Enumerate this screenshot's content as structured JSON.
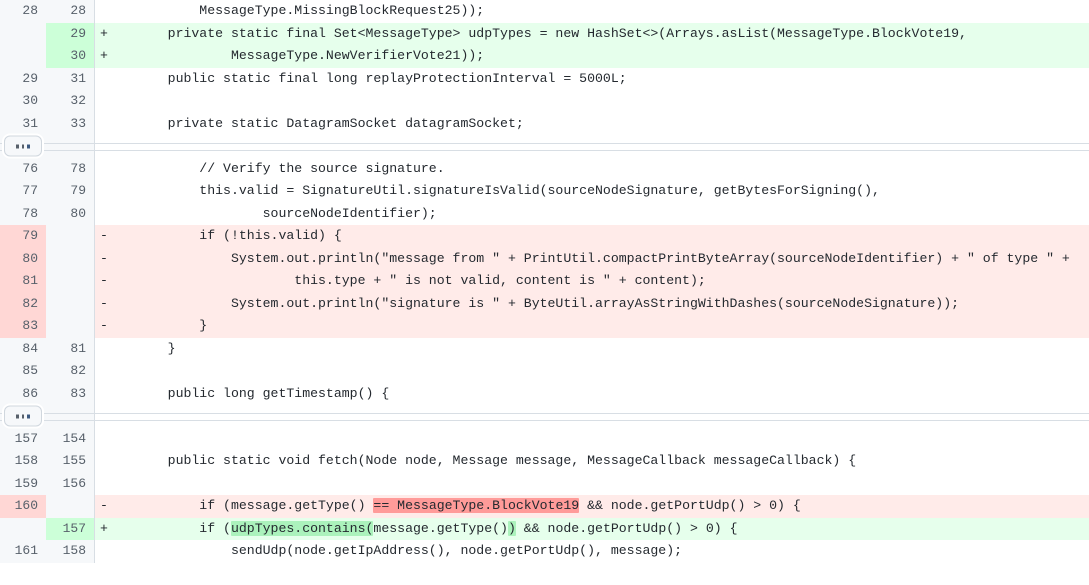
{
  "view": {
    "type": "unified-diff",
    "language": "java",
    "colors": {
      "added_bg": "#e6ffec",
      "added_gutter_bg": "#ccffd8",
      "added_word_highlight": "#abf2bc",
      "deleted_bg": "#ffebe9",
      "deleted_gutter_bg": "#ffd7d5",
      "deleted_word_highlight": "#ff9b99",
      "context_bg": "#ffffff",
      "gutter_bg": "#f6f8fa",
      "gutter_text": "#57606a",
      "code_text": "#24292f",
      "border": "#d8dee4"
    }
  },
  "expanders": [
    {
      "label": "...",
      "title": "Expand hidden lines"
    },
    {
      "label": "...",
      "title": "Expand hidden lines"
    }
  ],
  "rows": [
    {
      "kind": "context",
      "old": "28",
      "new": "28",
      "marker": "",
      "code": "        MessageType.MissingBlockRequest25));"
    },
    {
      "kind": "add",
      "old": "",
      "new": "29",
      "marker": "+",
      "code": "    private static final Set<MessageType> udpTypes = new HashSet<>(Arrays.asList(MessageType.BlockVote19,"
    },
    {
      "kind": "add",
      "old": "",
      "new": "30",
      "marker": "+",
      "code": "            MessageType.NewVerifierVote21));"
    },
    {
      "kind": "context",
      "old": "29",
      "new": "31",
      "marker": "",
      "code": "    public static final long replayProtectionInterval = 5000L;"
    },
    {
      "kind": "context",
      "old": "30",
      "new": "32",
      "marker": "",
      "code": ""
    },
    {
      "kind": "context",
      "old": "31",
      "new": "33",
      "marker": "",
      "code": "    private static DatagramSocket datagramSocket;"
    },
    {
      "kind": "expander",
      "index": 0
    },
    {
      "kind": "context",
      "old": "76",
      "new": "78",
      "marker": "",
      "code": "        // Verify the source signature."
    },
    {
      "kind": "context",
      "old": "77",
      "new": "79",
      "marker": "",
      "code": "        this.valid = SignatureUtil.signatureIsValid(sourceNodeSignature, getBytesForSigning(),"
    },
    {
      "kind": "context",
      "old": "78",
      "new": "80",
      "marker": "",
      "code": "                sourceNodeIdentifier);"
    },
    {
      "kind": "del",
      "old": "79",
      "new": "",
      "marker": "-",
      "code": "        if (!this.valid) {"
    },
    {
      "kind": "del",
      "old": "80",
      "new": "",
      "marker": "-",
      "code": "            System.out.println(\"message from \" + PrintUtil.compactPrintByteArray(sourceNodeIdentifier) + \" of type \" +"
    },
    {
      "kind": "del",
      "old": "81",
      "new": "",
      "marker": "-",
      "code": "                    this.type + \" is not valid, content is \" + content);"
    },
    {
      "kind": "del",
      "old": "82",
      "new": "",
      "marker": "-",
      "code": "            System.out.println(\"signature is \" + ByteUtil.arrayAsStringWithDashes(sourceNodeSignature));"
    },
    {
      "kind": "del",
      "old": "83",
      "new": "",
      "marker": "-",
      "code": "        }"
    },
    {
      "kind": "context",
      "old": "84",
      "new": "81",
      "marker": "",
      "code": "    }"
    },
    {
      "kind": "context",
      "old": "85",
      "new": "82",
      "marker": "",
      "code": ""
    },
    {
      "kind": "context",
      "old": "86",
      "new": "83",
      "marker": "",
      "code": "    public long getTimestamp() {"
    },
    {
      "kind": "expander",
      "index": 1
    },
    {
      "kind": "context",
      "old": "157",
      "new": "154",
      "marker": "",
      "code": ""
    },
    {
      "kind": "context",
      "old": "158",
      "new": "155",
      "marker": "",
      "code": "    public static void fetch(Node node, Message message, MessageCallback messageCallback) {"
    },
    {
      "kind": "context",
      "old": "159",
      "new": "156",
      "marker": "",
      "code": ""
    },
    {
      "kind": "del",
      "old": "160",
      "new": "",
      "marker": "-",
      "code": "        if (message.getType() == MessageType.BlockVote19 && node.getPortUdp() > 0) {",
      "segments": [
        {
          "text": "        if (message.getType() ",
          "hl": false
        },
        {
          "text": "== MessageType.BlockVote19",
          "hl": true
        },
        {
          "text": " && node.getPortUdp() > 0) {",
          "hl": false
        }
      ]
    },
    {
      "kind": "add",
      "old": "",
      "new": "157",
      "marker": "+",
      "code": "        if (udpTypes.contains(message.getType()) && node.getPortUdp() > 0) {",
      "segments": [
        {
          "text": "        if (",
          "hl": false
        },
        {
          "text": "udpTypes.contains(",
          "hl": true
        },
        {
          "text": "message.getType()",
          "hl": false
        },
        {
          "text": ")",
          "hl": true
        },
        {
          "text": " && node.getPortUdp() > 0) {",
          "hl": false
        }
      ]
    },
    {
      "kind": "context",
      "old": "161",
      "new": "158",
      "marker": "",
      "code": "            sendUdp(node.getIpAddress(), node.getPortUdp(), message);"
    }
  ]
}
